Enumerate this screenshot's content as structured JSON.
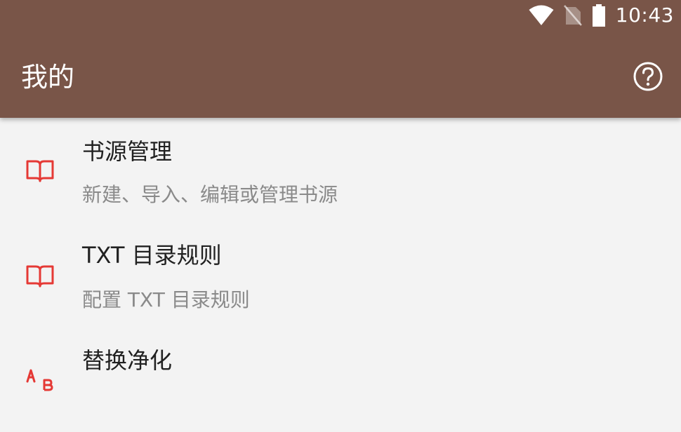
{
  "status_bar": {
    "time": "10:43",
    "icons": [
      "wifi-icon",
      "no-sim-icon",
      "battery-icon"
    ]
  },
  "toolbar": {
    "title": "我的",
    "help_icon": "help-circle-icon"
  },
  "colors": {
    "primary": "#795548",
    "icon_accent": "#e53935",
    "background": "#f3f3f3",
    "title_text": "#212121",
    "summary_text": "#8a8a8a"
  },
  "preferences": [
    {
      "title": "书源管理",
      "summary": "新建、导入、编辑或管理书源",
      "icon": "book-open-icon"
    },
    {
      "title": "TXT 目录规则",
      "summary": "配置 TXT 目录规则",
      "icon": "book-open-icon"
    },
    {
      "title": "替换净化",
      "summary": "",
      "icon": "find-replace-icon"
    }
  ]
}
